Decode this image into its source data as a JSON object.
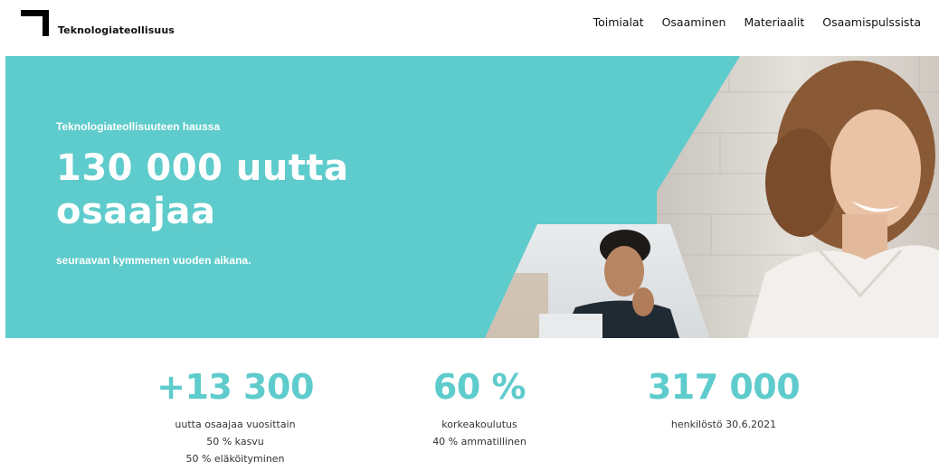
{
  "header": {
    "brand": "Teknologiateollisuus",
    "nav": [
      "Toimialat",
      "Osaaminen",
      "Materiaalit",
      "Osaamispulssista"
    ]
  },
  "hero": {
    "eyebrow": "Teknologiateollisuuteen haussa",
    "headline_line1": "130 000 uutta",
    "headline_line2": "osaajaa",
    "subline": "seuraavan kymmenen vuoden aikana.",
    "background_color": "#5ecbcc"
  },
  "stats": [
    {
      "value": "+13 300",
      "lines": [
        "uutta osaajaa vuosittain",
        "50 % kasvu",
        "50 % eläköityminen"
      ]
    },
    {
      "value": "60 %",
      "lines": [
        "korkeakoulutus",
        "40 % ammatillinen"
      ]
    },
    {
      "value": "317 000",
      "lines": [
        "henkilöstö 30.6.2021"
      ]
    }
  ],
  "accent_color": "#5ecbcc"
}
